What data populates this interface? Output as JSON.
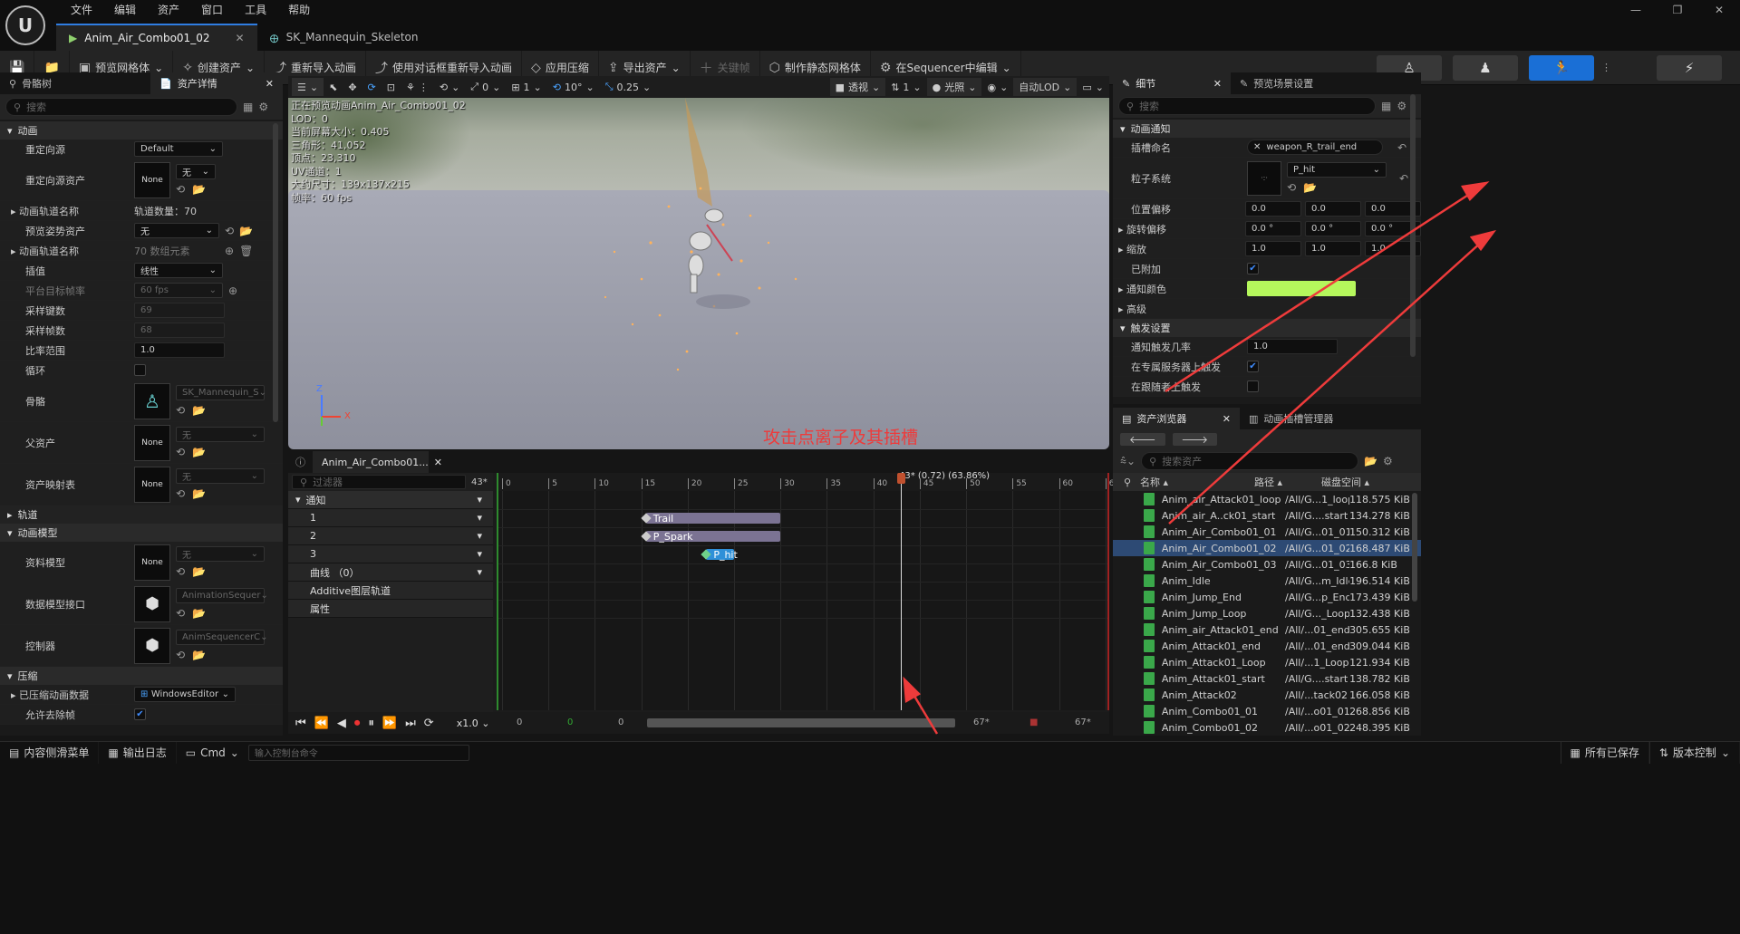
{
  "titlebar": {
    "menu": [
      "文件",
      "编辑",
      "资产",
      "窗口",
      "工具",
      "帮助"
    ],
    "tabs": [
      {
        "label": "Anim_Air_Combo01_02"
      },
      {
        "label": "SK_Mannequin_Skeleton"
      }
    ]
  },
  "toolbar": {
    "items": [
      {
        "label": "预览网格体",
        "icon": "mesh-icon"
      },
      {
        "label": "创建资产",
        "icon": "wand-icon"
      },
      {
        "label": "重新导入动画",
        "icon": "reimport-icon"
      },
      {
        "label": "使用对话框重新导入动画",
        "icon": "reimport-dialog-icon"
      },
      {
        "label": "应用压缩",
        "icon": "compress-icon"
      },
      {
        "label": "导出资产",
        "icon": "export-icon"
      },
      {
        "label": "关键帧",
        "icon": "plus-icon"
      },
      {
        "label": "制作静态网格体",
        "icon": "static-mesh-icon"
      },
      {
        "label": "在Sequencer中编辑",
        "icon": "sequencer-icon"
      }
    ]
  },
  "left": {
    "tabs": [
      "骨骼树",
      "资产详情"
    ],
    "search_placeholder": "搜索",
    "sections": {
      "anim": "动画",
      "track": "轨道",
      "model": "动画模型",
      "compress": "压缩"
    },
    "rows": {
      "retarget_source": {
        "label": "重定向源",
        "value": "Default"
      },
      "retarget_source_asset": {
        "label": "重定向源资产",
        "thumb": "None",
        "value": "无"
      },
      "track_names": {
        "label": "动画轨道名称",
        "value": "轨道数量：70"
      },
      "preview_pose": {
        "label": "预览姿势资产",
        "value": "无"
      },
      "track_names2": {
        "label": "动画轨道名称",
        "value": "70 数组元素"
      },
      "interp": {
        "label": "插值",
        "value": "线性"
      },
      "platform_rate": {
        "label": "平台目标帧率",
        "value": "60 fps"
      },
      "sample_keys": {
        "label": "采样键数",
        "value": "69"
      },
      "sample_frames": {
        "label": "采样帧数",
        "value": "68"
      },
      "rate_scale": {
        "label": "比率范围",
        "value": "1.0"
      },
      "loop": {
        "label": "循环"
      },
      "skeleton": {
        "label": "骨骼",
        "value": "SK_Mannequin_S"
      },
      "parent": {
        "label": "父资产",
        "thumb": "None",
        "value": "无"
      },
      "asset_map": {
        "label": "资产映射表",
        "thumb": "None",
        "value": "无"
      },
      "data_model": {
        "label": "资料模型",
        "thumb": "None",
        "value": "无"
      },
      "data_iface": {
        "label": "数据模型接口",
        "value": "AnimationSequer"
      },
      "controller": {
        "label": "控制器",
        "value": "AnimSequencerC"
      },
      "compressed": {
        "label": "已压缩动画数据",
        "value": "WindowsEditor"
      },
      "allow_strip": {
        "label": "允许去除帧"
      }
    }
  },
  "viewport": {
    "tools": {
      "snap_deg": "10°",
      "snap_scale": "0.25",
      "grid": "0",
      "fov": "1",
      "perspective": "透视",
      "lit": "光照",
      "lod": "自动LOD",
      "camera_speed": "1"
    },
    "stats": [
      "正在预览动画Anim_Air_Combo01_02",
      "LOD：0",
      "当前屏幕大小：0.405",
      "三角形：41,052",
      "顶点：23,310",
      "UV通道：1",
      "大约尺寸：139x137x215",
      "帧率：60 fps"
    ],
    "axis": {
      "z": "Z",
      "x": "X"
    },
    "annotation": "攻击点离子及其插槽"
  },
  "timeline": {
    "tab": "Anim_Air_Combo01...",
    "filter_placeholder": "过滤器",
    "frame_count": "43*",
    "playhead_label": "43* (0.72) (63.86%)",
    "ruler": [
      "0",
      "5",
      "10",
      "15",
      "20",
      "25",
      "30",
      "35",
      "40",
      "45",
      "50",
      "55",
      "60",
      "65"
    ],
    "tracks": [
      {
        "label": "通知"
      },
      {
        "label": "1"
      },
      {
        "label": "2"
      },
      {
        "label": "3"
      },
      {
        "label": "曲线 （0）"
      },
      {
        "label": "Additive图层轨道"
      },
      {
        "label": "属性"
      }
    ],
    "notifies": [
      {
        "label": "Trail",
        "start": 15.5,
        "end": 30
      },
      {
        "label": "P_Spark",
        "start": 15.5,
        "end": 30
      },
      {
        "label": "P_hit",
        "start": 22,
        "end": 25
      }
    ],
    "playhead": 43,
    "transport": {
      "speed": "x1.0",
      "start": "0",
      "mid": "0",
      "mid2": "0",
      "end": "67*",
      "end2": "67*"
    }
  },
  "details": {
    "tabs": [
      "细节",
      "预览场景设置"
    ],
    "search_placeholder": "搜索",
    "section_notify": "动画通知",
    "socket_label": "插槽命名",
    "socket_value": "weapon_R_trail_end",
    "particle_label": "粒子系统",
    "particle_value": "P_hit",
    "pos_label": "位置偏移",
    "pos": [
      "0.0",
      "0.0",
      "0.0"
    ],
    "rot_label": "旋转偏移",
    "rot": [
      "0.0 °",
      "0.0 °",
      "0.0 °"
    ],
    "scale_label": "缩放",
    "scale": [
      "1.0",
      "1.0",
      "1.0"
    ],
    "attached_label": "已附加",
    "color_label": "通知颜色",
    "notify_color": "#b5f75c",
    "advanced_label": "高级",
    "section_trigger": "触发设置",
    "chance_label": "通知触发几率",
    "chance_value": "1.0",
    "dedicated_label": "在专属服务器上触发",
    "follower_label": "在跟随者上触发"
  },
  "browser": {
    "tabs": [
      "资产浏览器",
      "动画插槽管理器"
    ],
    "search_placeholder": "搜索资产",
    "columns": [
      "名称",
      "路径",
      "磁盘空间"
    ],
    "rows": [
      {
        "name": "Anim_air_Attack01_loop",
        "path": "/All/G...1_loop",
        "size": "118.575 KiB"
      },
      {
        "name": "Anim_air_A..ck01_start",
        "path": "/All/G....start",
        "size": "134.278 KiB"
      },
      {
        "name": "Anim_Air_Combo01_01",
        "path": "/All/G...01_01",
        "size": "150.312 KiB"
      },
      {
        "name": "Anim_Air_Combo01_02",
        "path": "/All/G...01_02",
        "size": "168.487 KiB",
        "selected": true
      },
      {
        "name": "Anim_Air_Combo01_03",
        "path": "/All/G...01_03",
        "size": "166.8 KiB"
      },
      {
        "name": "Anim_Idle",
        "path": "/All/G...m_Idle",
        "size": "196.514 KiB"
      },
      {
        "name": "Anim_Jump_End",
        "path": "/All/G...p_End",
        "size": "173.439 KiB"
      },
      {
        "name": "Anim_Jump_Loop",
        "path": "/All/G..._Loop",
        "size": "132.438 KiB"
      },
      {
        "name": "Anim_air_Attack01_end",
        "path": "/All/...01_end",
        "size": "305.655 KiB"
      },
      {
        "name": "Anim_Attack01_end",
        "path": "/All/...01_end",
        "size": "309.044 KiB"
      },
      {
        "name": "Anim_Attack01_Loop",
        "path": "/All/...1_Loop",
        "size": "121.934 KiB"
      },
      {
        "name": "Anim_Attack01_start",
        "path": "/All/G....start",
        "size": "138.782 KiB"
      },
      {
        "name": "Anim_Attack02",
        "path": "/All/...tack02",
        "size": "166.058 KiB"
      },
      {
        "name": "Anim_Combo01_01",
        "path": "/All/...o01_01",
        "size": "268.856 KiB"
      },
      {
        "name": "Anim_Combo01_02",
        "path": "/All/...o01_02",
        "size": "248.395 KiB"
      }
    ]
  },
  "status": {
    "content_drawer": "内容侧滑菜单",
    "output_log": "输出日志",
    "cmd": "Cmd",
    "console_placeholder": "输入控制台命令",
    "saved": "所有已保存",
    "source_control": "版本控制"
  }
}
